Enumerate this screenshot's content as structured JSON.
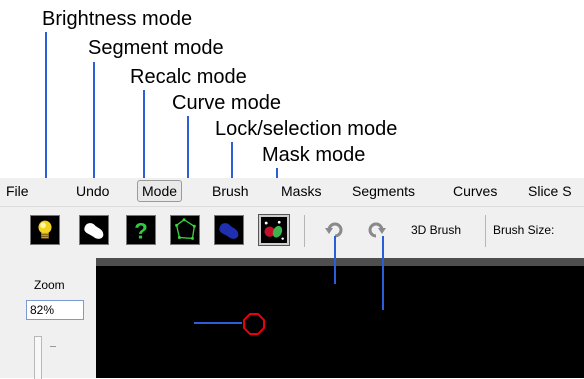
{
  "callouts": {
    "brightness": "Brightness mode",
    "segment": "Segment mode",
    "recalc": "Recalc mode",
    "curve": "Curve mode",
    "lock": "Lock/selection mode",
    "mask": "Mask mode",
    "undo": "Undo",
    "redo": "Redo",
    "brush": "Brush"
  },
  "menu": [
    "File",
    "Undo",
    "Mode",
    "Brush",
    "Masks",
    "Segments",
    "Curves",
    "Slice S"
  ],
  "menu_active": "Mode",
  "toolbar": {
    "brush3d_label": "3D Brush",
    "brush_size_label": "Brush Size:"
  },
  "zoom": {
    "label": "Zoom",
    "value": "82%"
  },
  "colors": {
    "leader": "#2b5fd9",
    "brush_cursor": "#e8000b",
    "canvas": "#000000"
  },
  "icons": {
    "brightness": "lightbulb-icon",
    "segment": "white-blob-icon",
    "recalc": "question-mark-icon",
    "curve": "curve-polygon-icon",
    "lock": "blue-blob-icon",
    "mask": "mask-icon",
    "undo": "undo-arrow-icon",
    "redo": "redo-arrow-icon"
  }
}
